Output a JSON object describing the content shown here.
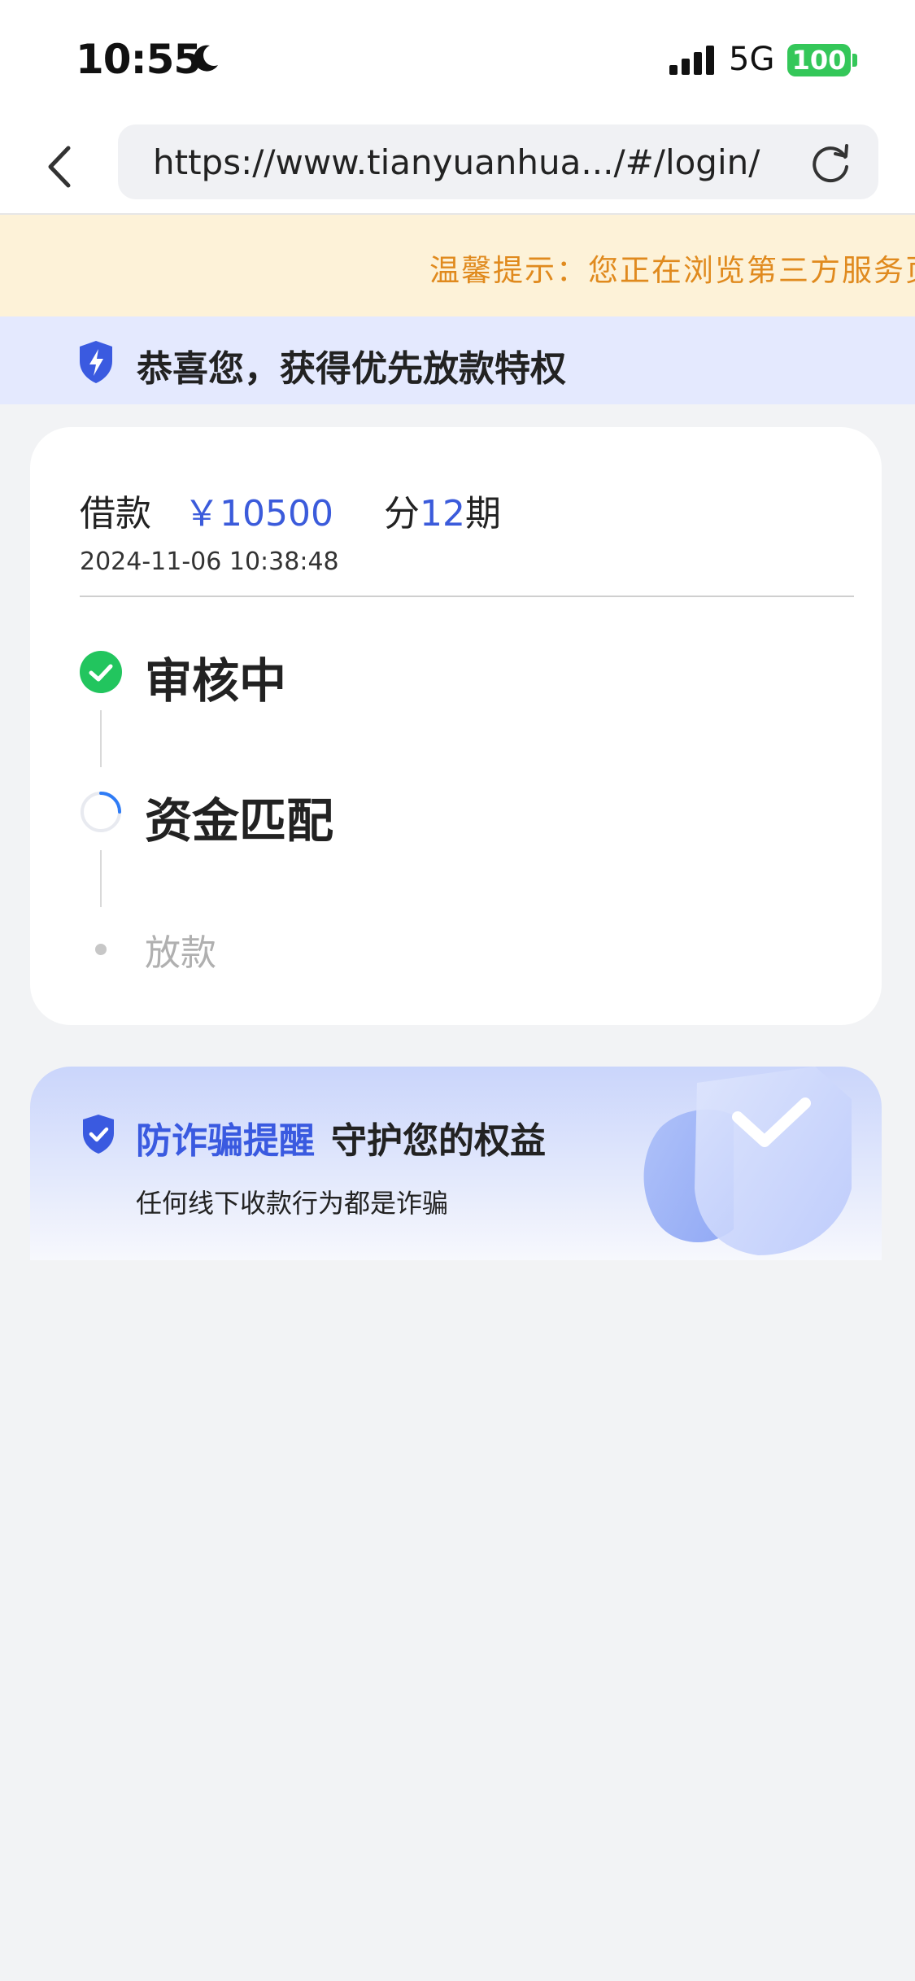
{
  "status_bar": {
    "time": "10:55",
    "network": "5G",
    "battery": "100"
  },
  "browser": {
    "url": "https://www.tianyuanhua.../#/login/"
  },
  "notice": {
    "text": "温馨提示：您正在浏览第三方服务页"
  },
  "privilege_banner": {
    "text": "恭喜您，获得优先放款特权"
  },
  "loan": {
    "label": "借款",
    "amount": "￥10500",
    "term_prefix": "分",
    "term_number": "12",
    "term_suffix": "期",
    "date": "2024-11-06 10:38:48"
  },
  "steps": [
    {
      "label": "审核中",
      "state": "done"
    },
    {
      "label": "资金匹配",
      "state": "in-progress"
    },
    {
      "label": "放款",
      "state": "pending"
    }
  ],
  "fraud_reminder": {
    "title": "防诈骗提醒",
    "subtitle": "守护您的权益",
    "description": "任何线下收款行为都是诈骗"
  },
  "colors": {
    "accent_blue": "#3b5bdb",
    "success_green": "#22c55e",
    "notice_orange": "#e08a1e",
    "page_background": "#f2f3f5"
  },
  "icons": [
    "moon-icon",
    "signal-icon",
    "back-arrow-icon",
    "reload-icon",
    "shield-lightning-icon",
    "check-circle-icon",
    "loading-spinner-icon",
    "shield-check-icon"
  ]
}
